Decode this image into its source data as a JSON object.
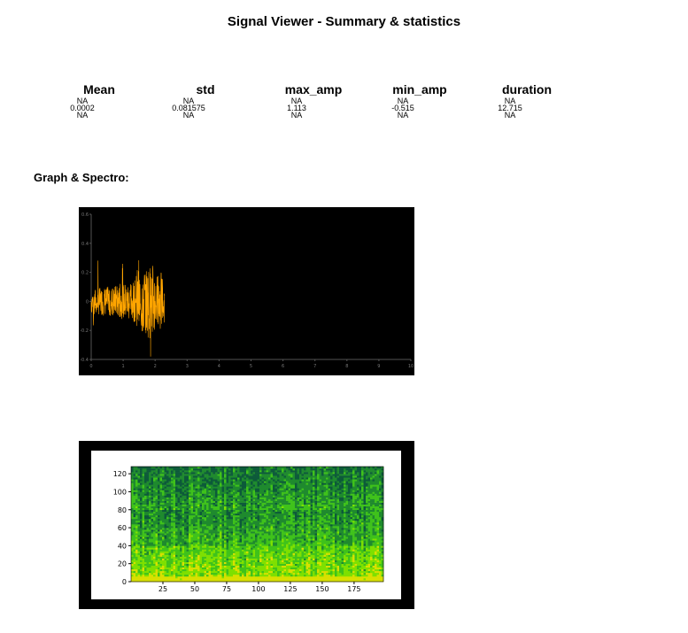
{
  "title": "Signal Viewer - Summary & statistics",
  "stats": {
    "columns": [
      {
        "header": "Mean",
        "values": [
          "NA",
          "0.0002",
          "NA"
        ]
      },
      {
        "header": "std",
        "values": [
          "NA",
          "0.081575",
          "NA"
        ]
      },
      {
        "header": "max_amp",
        "values": [
          "NA",
          "1.113",
          "NA"
        ]
      },
      {
        "header": "min_amp",
        "values": [
          "NA",
          "-0.515",
          "NA"
        ]
      },
      {
        "header": "duration",
        "values": [
          "NA",
          "12.715",
          "NA"
        ]
      }
    ]
  },
  "section_label": "Graph & Spectro:",
  "chart_data": [
    {
      "type": "line",
      "title": "",
      "xlabel": "",
      "ylabel": "",
      "xlim": [
        0,
        10
      ],
      "ylim": [
        -0.4,
        0.6
      ],
      "x_ticks": [
        "0",
        "1",
        "2",
        "3",
        "4",
        "5",
        "6",
        "7",
        "8",
        "9",
        "10"
      ],
      "y_ticks": [
        "0.6",
        "0.4",
        "0.2",
        "0",
        "-0.2",
        "-0.4"
      ],
      "signal_extent": [
        0,
        2.3
      ],
      "series_color": "#ffa500",
      "background": "#000000"
    },
    {
      "type": "heatmap",
      "title": "",
      "xlabel": "",
      "ylabel": "",
      "xlim": [
        0,
        198
      ],
      "ylim": [
        0,
        128
      ],
      "x_ticks": [
        "25",
        "50",
        "75",
        "100",
        "125",
        "150",
        "175"
      ],
      "y_ticks": [
        "0",
        "20",
        "40",
        "60",
        "80",
        "100",
        "120"
      ],
      "colors": [
        "#0d5a3a",
        "#1f8a2e",
        "#3fc21b",
        "#7ee000",
        "#d8e000"
      ]
    }
  ]
}
